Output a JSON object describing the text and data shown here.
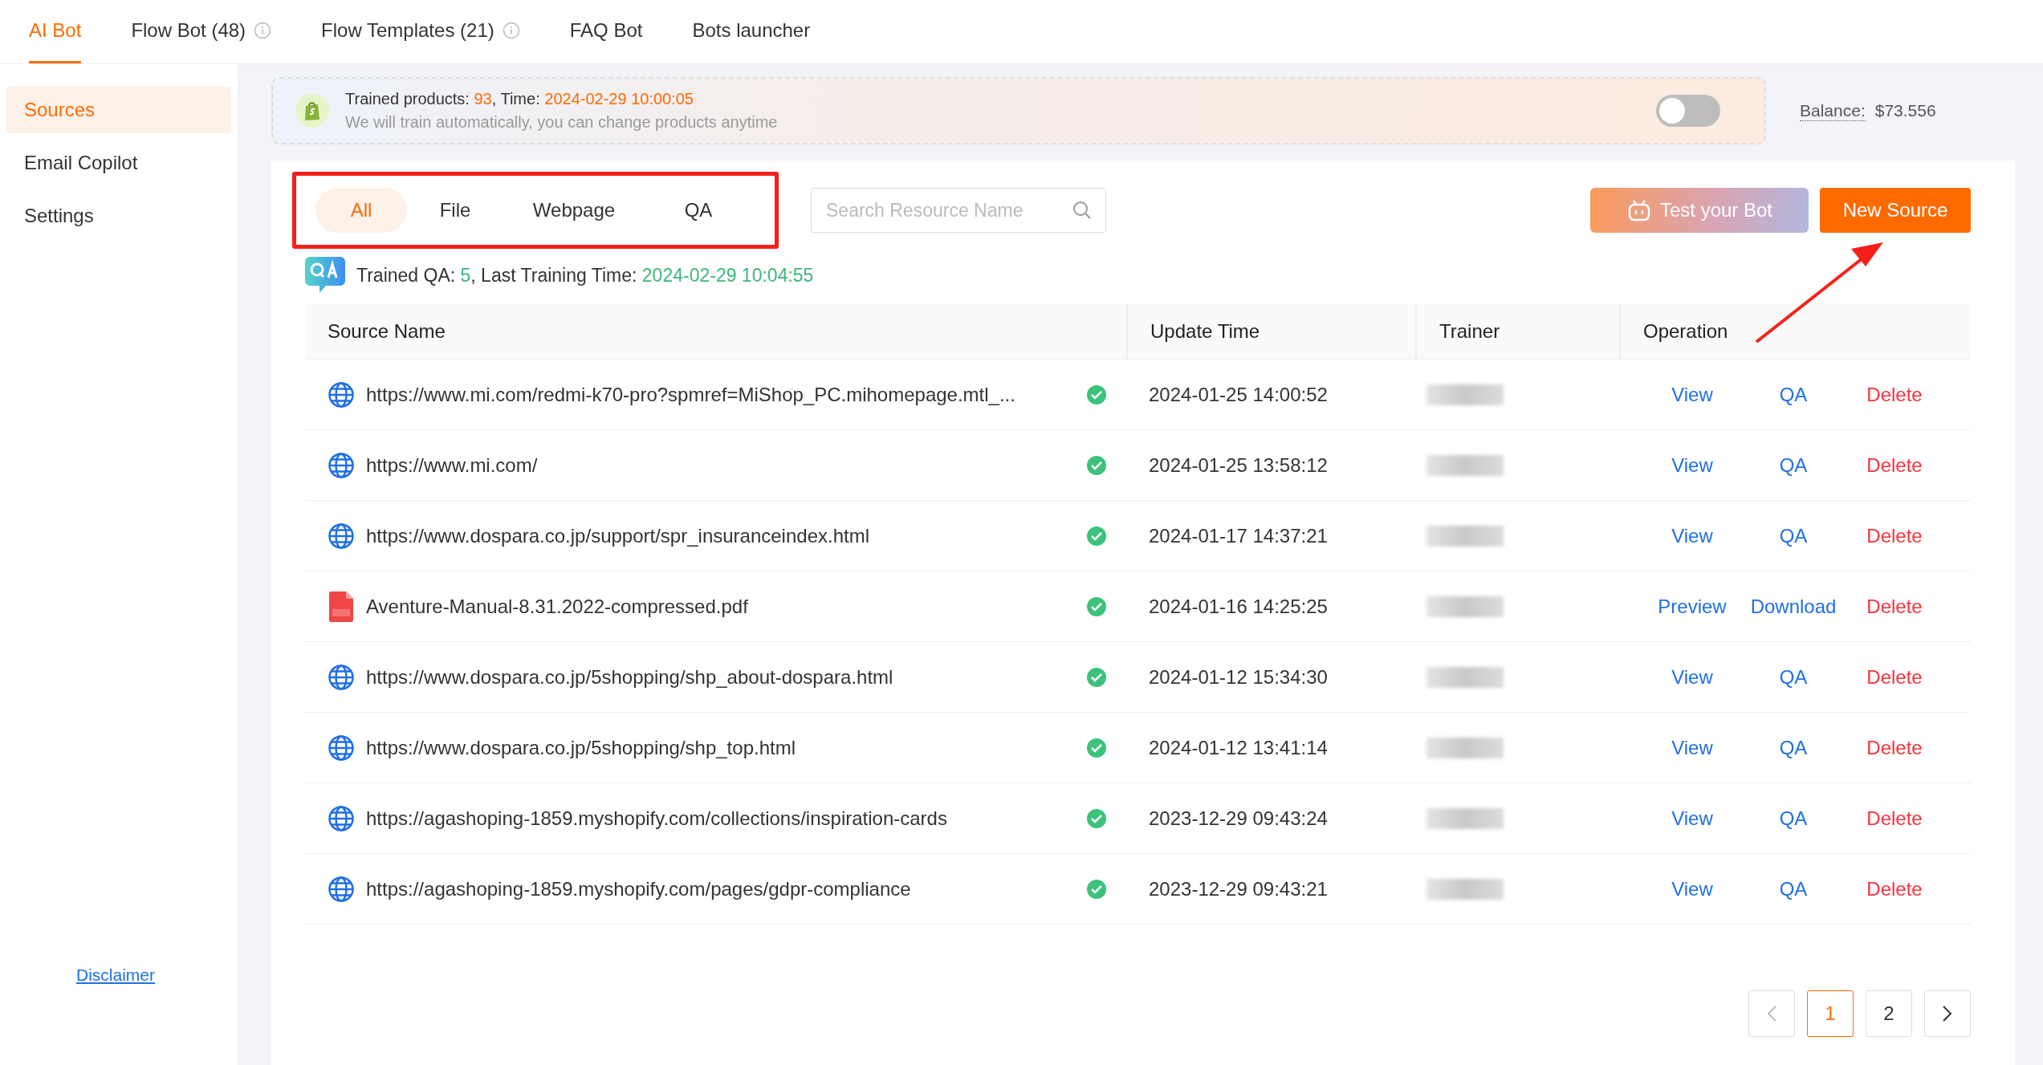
{
  "top_tabs": [
    {
      "label": "AI Bot",
      "selected": true,
      "info": false
    },
    {
      "label": "Flow Bot (48)",
      "selected": false,
      "info": true
    },
    {
      "label": "Flow Templates (21)",
      "selected": false,
      "info": true
    },
    {
      "label": "FAQ Bot",
      "selected": false,
      "info": false
    },
    {
      "label": "Bots launcher",
      "selected": false,
      "info": false
    }
  ],
  "sidebar": {
    "items": [
      {
        "label": "Sources",
        "selected": true
      },
      {
        "label": "Email Copilot",
        "selected": false
      },
      {
        "label": "Settings",
        "selected": false
      }
    ],
    "footer_link": "Disclaimer"
  },
  "banner": {
    "label": "Trained products: ",
    "count": "93",
    "time_label": ", Time: ",
    "time": "2024-02-29 10:00:05",
    "hint": "We will train automatically, you can change products anytime",
    "toggle_on": false
  },
  "balance": {
    "label": "Balance:",
    "value": "$73.556"
  },
  "filters": [
    {
      "label": "All",
      "selected": true
    },
    {
      "label": "File",
      "selected": false
    },
    {
      "label": "Webpage",
      "selected": false
    },
    {
      "label": "QA",
      "selected": false
    }
  ],
  "search": {
    "placeholder": "Search Resource Name"
  },
  "buttons": {
    "test": "Test your Bot",
    "new": "New Source"
  },
  "qa_status": {
    "label": "Trained QA: ",
    "count": "5",
    "time_label": ", Last Training Time: ",
    "time": "2024-02-29 10:04:55"
  },
  "table": {
    "columns": [
      "Source Name",
      "Update Time",
      "Trainer",
      "Operation"
    ],
    "rows": [
      {
        "kind": "web",
        "name": "https://www.mi.com/redmi-k70-pro?spmref=MiShop_PC.mihomepage.mtl_...",
        "trained": true,
        "time": "2024-01-25 14:00:52",
        "actions": [
          {
            "label": "View",
            "kind": "link"
          },
          {
            "label": "QA",
            "kind": "link"
          },
          {
            "label": "Delete",
            "kind": "danger"
          }
        ]
      },
      {
        "kind": "web",
        "name": "https://www.mi.com/",
        "trained": true,
        "time": "2024-01-25 13:58:12",
        "actions": [
          {
            "label": "View",
            "kind": "link"
          },
          {
            "label": "QA",
            "kind": "link"
          },
          {
            "label": "Delete",
            "kind": "danger"
          }
        ]
      },
      {
        "kind": "web",
        "name": "https://www.dospara.co.jp/support/spr_insuranceindex.html",
        "trained": true,
        "time": "2024-01-17 14:37:21",
        "actions": [
          {
            "label": "View",
            "kind": "link"
          },
          {
            "label": "QA",
            "kind": "link"
          },
          {
            "label": "Delete",
            "kind": "danger"
          }
        ]
      },
      {
        "kind": "pdf",
        "name": "Aventure-Manual-8.31.2022-compressed.pdf",
        "trained": true,
        "time": "2024-01-16 14:25:25",
        "actions": [
          {
            "label": "Preview",
            "kind": "link"
          },
          {
            "label": "Download",
            "kind": "link"
          },
          {
            "label": "Delete",
            "kind": "danger"
          }
        ]
      },
      {
        "kind": "web",
        "name": "https://www.dospara.co.jp/5shopping/shp_about-dospara.html",
        "trained": true,
        "time": "2024-01-12 15:34:30",
        "actions": [
          {
            "label": "View",
            "kind": "link"
          },
          {
            "label": "QA",
            "kind": "link"
          },
          {
            "label": "Delete",
            "kind": "danger"
          }
        ]
      },
      {
        "kind": "web",
        "name": "https://www.dospara.co.jp/5shopping/shp_top.html",
        "trained": true,
        "time": "2024-01-12 13:41:14",
        "actions": [
          {
            "label": "View",
            "kind": "link"
          },
          {
            "label": "QA",
            "kind": "link"
          },
          {
            "label": "Delete",
            "kind": "danger"
          }
        ]
      },
      {
        "kind": "web",
        "name": "https://agashoping-1859.myshopify.com/collections/inspiration-cards",
        "trained": true,
        "time": "2023-12-29 09:43:24",
        "actions": [
          {
            "label": "View",
            "kind": "link"
          },
          {
            "label": "QA",
            "kind": "link"
          },
          {
            "label": "Delete",
            "kind": "danger"
          }
        ]
      },
      {
        "kind": "web",
        "name": "https://agashoping-1859.myshopify.com/pages/gdpr-compliance",
        "trained": true,
        "time": "2023-12-29 09:43:21",
        "actions": [
          {
            "label": "View",
            "kind": "link"
          },
          {
            "label": "QA",
            "kind": "link"
          },
          {
            "label": "Delete",
            "kind": "danger"
          }
        ]
      }
    ]
  },
  "pagination": {
    "pages": [
      {
        "label": "1",
        "selected": true
      },
      {
        "label": "2",
        "selected": false
      }
    ]
  }
}
